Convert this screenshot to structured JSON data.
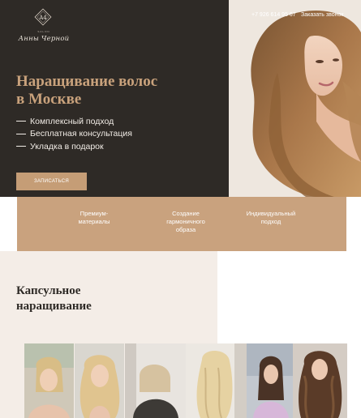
{
  "brand": {
    "logo_monogram": "A4",
    "logo_small": "SALON",
    "logo_name": "Анны Черной"
  },
  "header": {
    "phone": "+7 926 614 95 67",
    "callback_label": "Заказать звонок"
  },
  "hero": {
    "title_line1": "Наращивание волос",
    "title_line2": "в Москве",
    "benefits": [
      "Комплексный подход",
      "Бесплатная консультация",
      "Укладка в подарок"
    ],
    "cta_label": "ЗАПИСАТЬСЯ"
  },
  "features": [
    {
      "line1": "Премиум-",
      "line2": "материалы",
      "line3": ""
    },
    {
      "line1": "Создание",
      "line2": "гармоничного",
      "line3": "образа"
    },
    {
      "line1": "Индивидуальный",
      "line2": "подход",
      "line3": ""
    }
  ],
  "capsule": {
    "title_line1": "Капсульное",
    "title_line2": "наращивание"
  },
  "gallery": [
    {
      "icon": "before-photo"
    },
    {
      "icon": "after-photo"
    },
    {
      "icon": "before-photo"
    },
    {
      "icon": "after-photo"
    },
    {
      "icon": "before-photo"
    },
    {
      "icon": "after-photo"
    }
  ],
  "colors": {
    "dark": "#2e2a26",
    "accent": "#c9a27c",
    "band": "#c9a27e",
    "soft_bg": "#f4ede7"
  }
}
